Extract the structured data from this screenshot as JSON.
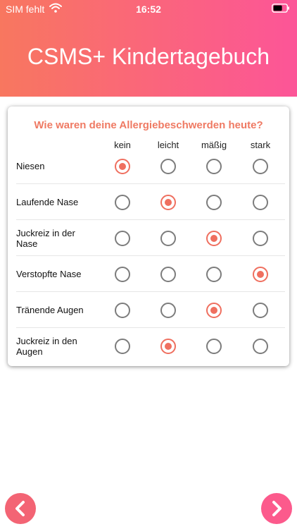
{
  "status_bar": {
    "carrier": "SIM fehlt",
    "time": "16:52",
    "wifi_icon": "wifi-icon",
    "battery_icon": "battery-icon"
  },
  "header": {
    "title": "CSMS+ Kindertagebuch",
    "gradient_start": "#f8775f",
    "gradient_end": "#fc5598"
  },
  "survey": {
    "question": "Wie waren deine Allergiebeschwerden heute?",
    "accent_color": "#ef6f5f",
    "columns": [
      "kein",
      "leicht",
      "mäßig",
      "stark"
    ],
    "rows": [
      {
        "label": "Niesen",
        "selected": 0
      },
      {
        "label": "Laufende Nase",
        "selected": 1
      },
      {
        "label": "Juckreiz in der Nase",
        "selected": 2
      },
      {
        "label": "Verstopfte Nase",
        "selected": 3
      },
      {
        "label": "Tränende Augen",
        "selected": 2
      },
      {
        "label": "Juckreiz in den Augen",
        "selected": 1
      }
    ]
  },
  "navigation": {
    "prev_icon": "chevron-left-icon",
    "next_icon": "chevron-right-icon"
  }
}
